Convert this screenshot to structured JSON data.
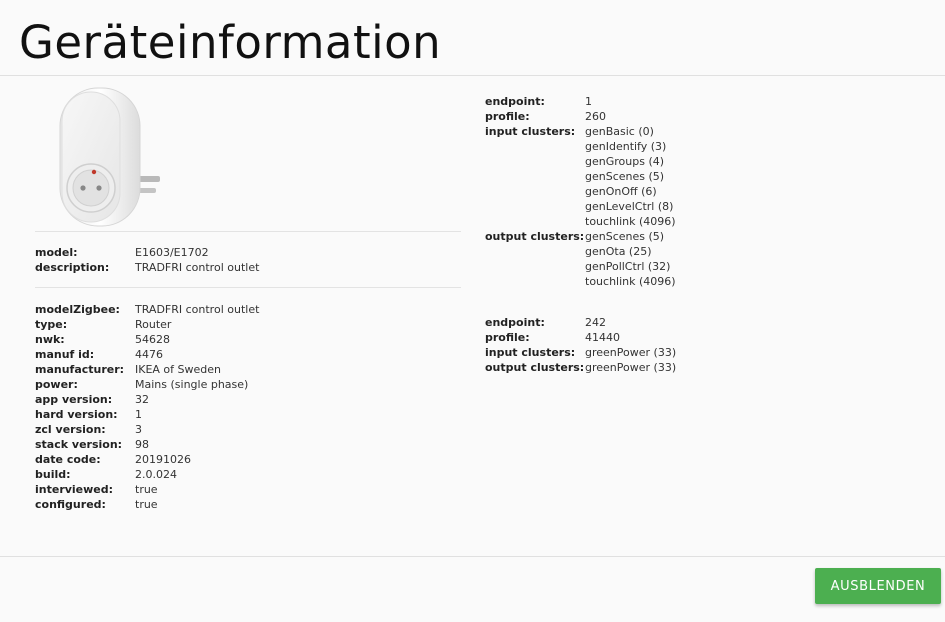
{
  "dialog": {
    "title": "Geräteinformation",
    "hide_button_label": "AUSBLENDEN",
    "accent_color": "#4caf50",
    "link_color": "#2a7bbf"
  },
  "device_image": {
    "alt": "E1603/E1702",
    "icon": "smart-plug-image"
  },
  "summary": [
    {
      "key": "model:",
      "value": "E1603/E1702",
      "link": true
    },
    {
      "key": "description:",
      "value": "TRADFRI control outlet"
    }
  ],
  "details": [
    {
      "key": "modelZigbee:",
      "value": "TRADFRI control outlet"
    },
    {
      "key": "type:",
      "value": "Router"
    },
    {
      "key": "nwk:",
      "value": "54628"
    },
    {
      "key": "manuf id:",
      "value": "4476"
    },
    {
      "key": "manufacturer:",
      "value": "IKEA of Sweden"
    },
    {
      "key": "power:",
      "value": "Mains (single phase)"
    },
    {
      "key": "app version:",
      "value": "32"
    },
    {
      "key": "hard version:",
      "value": "1"
    },
    {
      "key": "zcl version:",
      "value": "3"
    },
    {
      "key": "stack version:",
      "value": "98"
    },
    {
      "key": "date code:",
      "value": "20191026"
    },
    {
      "key": "build:",
      "value": "2.0.024"
    },
    {
      "key": "interviewed:",
      "value": "true"
    },
    {
      "key": "configured:",
      "value": "true"
    }
  ],
  "endpoints": [
    {
      "endpoint_label": "endpoint:",
      "endpoint": "1",
      "profile_label": "profile:",
      "profile": "260",
      "input_label": "input clusters:",
      "input_clusters": [
        "genBasic (0)",
        "genIdentify (3)",
        "genGroups (4)",
        "genScenes (5)",
        "genOnOff (6)",
        "genLevelCtrl (8)",
        "touchlink (4096)"
      ],
      "output_label": "output clusters:",
      "output_clusters": [
        "genScenes (5)",
        "genOta (25)",
        "genPollCtrl (32)",
        "touchlink (4096)"
      ]
    },
    {
      "endpoint_label": "endpoint:",
      "endpoint": "242",
      "profile_label": "profile:",
      "profile": "41440",
      "input_label": "input clusters:",
      "input_clusters": [
        "greenPower (33)"
      ],
      "output_label": "output clusters:",
      "output_clusters": [
        "greenPower (33)"
      ]
    }
  ]
}
